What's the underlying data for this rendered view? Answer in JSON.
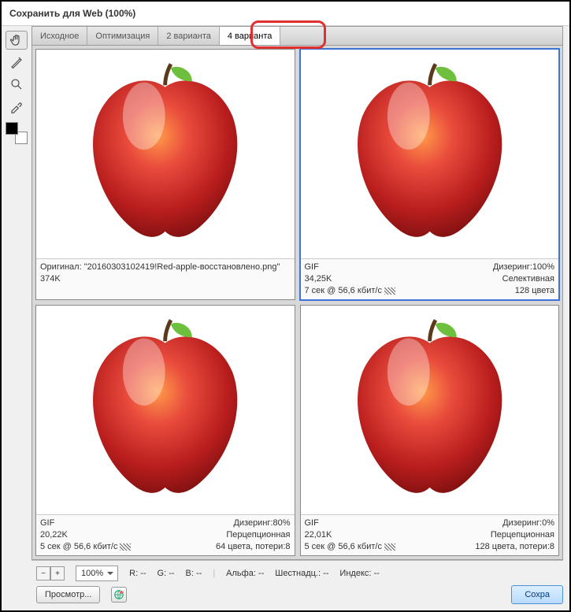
{
  "window": {
    "title": "Сохранить для Web (100%)"
  },
  "tabs": [
    "Исходное",
    "Оптимизация",
    "2 варианта",
    "4 варианта"
  ],
  "panes": [
    {
      "line1": "Оригинал: \"20160303102419!Red-apple-восстановлено.png\"",
      "line2": "374K"
    },
    {
      "format": "GIF",
      "size": "34,25K",
      "time": "7 сек @ 56,6 кбит/с",
      "dither": "Дизеринг:100%",
      "palette": "Селективная",
      "colors": "128 цвета"
    },
    {
      "format": "GIF",
      "size": "20,22K",
      "time": "5 сек @ 56,6 кбит/с",
      "dither": "Дизеринг:80%",
      "palette": "Перцепционная",
      "colors": "64 цвета, потери:8"
    },
    {
      "format": "GIF",
      "size": "22,01K",
      "time": "5 сек @ 56,6 кбит/с",
      "dither": "Дизеринг:0%",
      "palette": "Перцепционная",
      "colors": "128 цвета, потери:8"
    }
  ],
  "footer": {
    "zoom": "100%",
    "r": "R: --",
    "g": "G: --",
    "b": "B: --",
    "alpha": "Альфа: --",
    "hex": "Шестнадц.: --",
    "index": "Индекс: --",
    "preview": "Просмотр...",
    "save": "Сохра"
  }
}
